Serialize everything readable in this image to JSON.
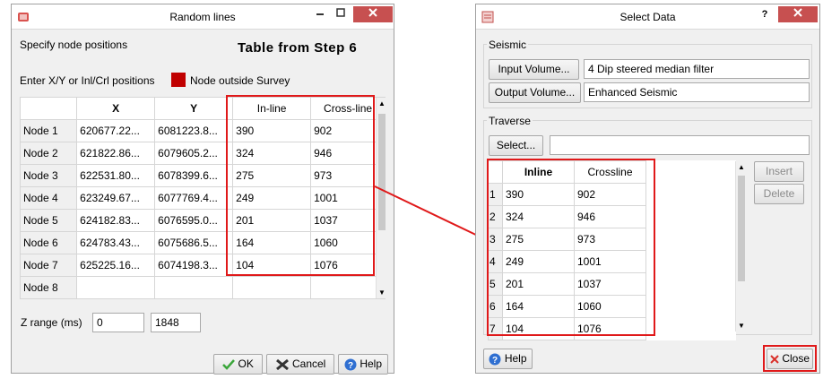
{
  "left_window": {
    "title": "Random lines",
    "specify_label": "Specify node positions",
    "step_label": "Table from Step 6",
    "enter_label": "Enter X/Y or Inl/Crl positions",
    "legend_label": "Node outside Survey",
    "legend_color": "#c00000",
    "headers": [
      "X",
      "Y",
      "In-line",
      "Cross-line"
    ],
    "rows": [
      {
        "name": "Node 1",
        "x": "620677.22...",
        "y": "6081223.8...",
        "inl": "390",
        "crl": "902"
      },
      {
        "name": "Node 2",
        "x": "621822.86...",
        "y": "6079605.2...",
        "inl": "324",
        "crl": "946"
      },
      {
        "name": "Node 3",
        "x": "622531.80...",
        "y": "6078399.6...",
        "inl": "275",
        "crl": "973"
      },
      {
        "name": "Node 4",
        "x": "623249.67...",
        "y": "6077769.4...",
        "inl": "249",
        "crl": "1001"
      },
      {
        "name": "Node 5",
        "x": "624182.83...",
        "y": "6076595.0...",
        "inl": "201",
        "crl": "1037"
      },
      {
        "name": "Node 6",
        "x": "624783.43...",
        "y": "6075686.5...",
        "inl": "164",
        "crl": "1060"
      },
      {
        "name": "Node 7",
        "x": "625225.16...",
        "y": "6074198.3...",
        "inl": "104",
        "crl": "1076"
      },
      {
        "name": "Node 8",
        "x": "",
        "y": "",
        "inl": "",
        "crl": ""
      }
    ],
    "z_label": "Z range (ms)",
    "z_from": "0",
    "z_to": "1848",
    "ok_label": "OK",
    "cancel_label": "Cancel",
    "help_label": "Help"
  },
  "right_window": {
    "title": "Select Data",
    "seismic_label": "Seismic",
    "input_volume_button": "Input Volume...",
    "input_volume_value": "4 Dip steered median filter",
    "output_volume_button": "Output Volume...",
    "output_volume_value": "Enhanced Seismic",
    "traverse_label": "Traverse",
    "select_button": "Select...",
    "select_value": "",
    "headers": [
      "Inline",
      "Crossline"
    ],
    "rows": [
      {
        "num": "1",
        "inl": "390",
        "crl": "902"
      },
      {
        "num": "2",
        "inl": "324",
        "crl": "946"
      },
      {
        "num": "3",
        "inl": "275",
        "crl": "973"
      },
      {
        "num": "4",
        "inl": "249",
        "crl": "1001"
      },
      {
        "num": "5",
        "inl": "201",
        "crl": "1037"
      },
      {
        "num": "6",
        "inl": "164",
        "crl": "1060"
      },
      {
        "num": "7",
        "inl": "104",
        "crl": "1076"
      }
    ],
    "insert_button": "Insert",
    "delete_button": "Delete",
    "help_label": "Help",
    "close_label": "Close",
    "help_title_glyph": "?"
  },
  "colors": {
    "highlight_red": "#e0191a",
    "close_red": "#c75050"
  }
}
